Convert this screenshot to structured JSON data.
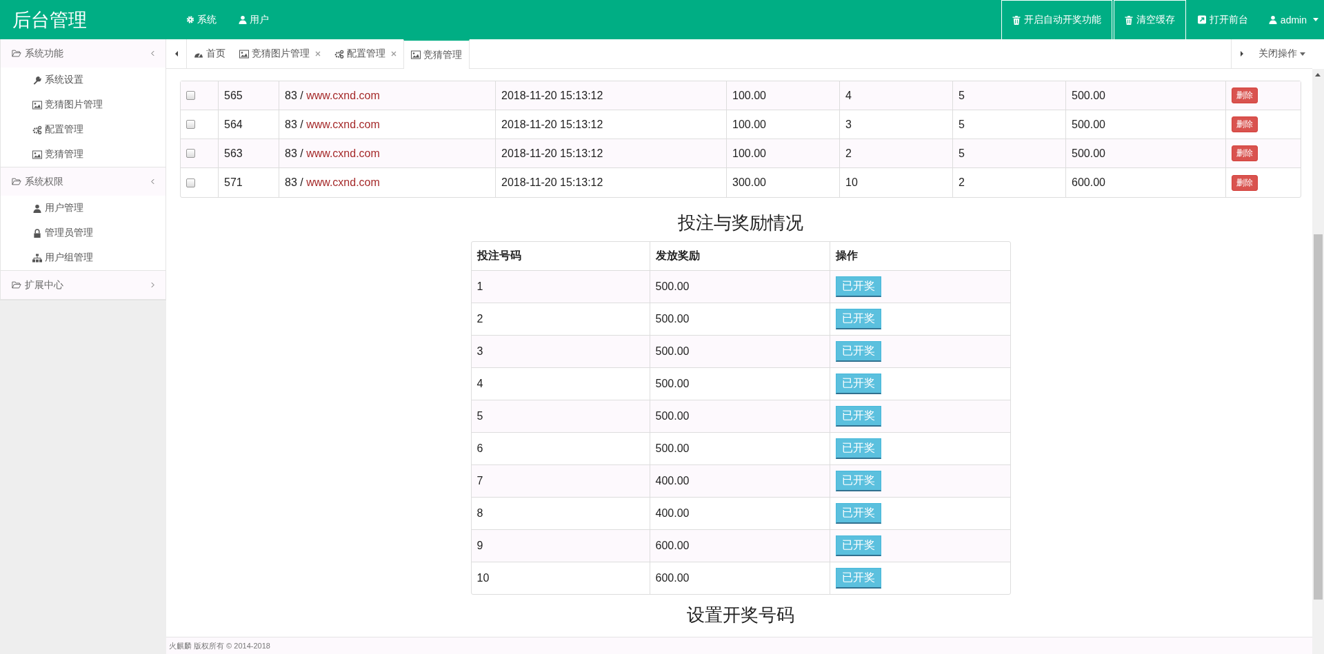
{
  "header": {
    "title": "后台管理",
    "menu": [
      {
        "label": "系统"
      },
      {
        "label": "用户"
      }
    ],
    "actions": [
      {
        "label": "开启自动开奖功能",
        "kind": "boxed"
      },
      {
        "label": "清空缓存",
        "kind": "boxed"
      },
      {
        "label": "打开前台",
        "kind": "plain"
      }
    ],
    "user": "admin"
  },
  "sidebar": {
    "groups": [
      {
        "label": "系统功能",
        "expanded": true,
        "children": [
          {
            "label": "系统设置"
          },
          {
            "label": "竞猜图片管理"
          },
          {
            "label": "配置管理"
          },
          {
            "label": "竞猜管理"
          }
        ]
      },
      {
        "label": "系统权限",
        "expanded": true,
        "children": [
          {
            "label": "用户管理"
          },
          {
            "label": "管理员管理"
          },
          {
            "label": "用户组管理"
          }
        ]
      },
      {
        "label": "扩展中心",
        "expanded": false
      }
    ]
  },
  "tabs": [
    {
      "label": "首页",
      "closable": false,
      "selected": false
    },
    {
      "label": "竞猜图片管理",
      "closable": true,
      "selected": false
    },
    {
      "label": "配置管理",
      "closable": true,
      "selected": false
    },
    {
      "label": "竞猜管理",
      "closable": false,
      "selected": true
    }
  ],
  "tab_close_all": "关闭操作",
  "bets_table": {
    "rows": [
      {
        "checked": false,
        "id": "565",
        "prefix": "83 / ",
        "link": "www.cxnd.com",
        "time": "2018-11-20 15:13:12",
        "column_5": "100.00",
        "column_6": "4",
        "column_7": "5",
        "column_8": "500.00",
        "action": "删除"
      },
      {
        "checked": false,
        "id": "564",
        "prefix": "83 / ",
        "link": "www.cxnd.com",
        "time": "2018-11-20 15:13:12",
        "column_5": "100.00",
        "column_6": "3",
        "column_7": "5",
        "column_8": "500.00",
        "action": "删除"
      },
      {
        "checked": false,
        "id": "563",
        "prefix": "83 / ",
        "link": "www.cxnd.com",
        "time": "2018-11-20 15:13:12",
        "column_5": "100.00",
        "column_6": "2",
        "column_7": "5",
        "column_8": "500.00",
        "action": "删除"
      },
      {
        "checked": false,
        "id": "571",
        "prefix": "83 / ",
        "link": "www.cxnd.com",
        "time": "2018-11-20 15:13:12",
        "column_5": "300.00",
        "column_6": "10",
        "column_7": "2",
        "column_8": "600.00",
        "action": "删除"
      }
    ]
  },
  "rewards": {
    "title": "投注与奖励情况",
    "columns": [
      "投注号码",
      "发放奖励",
      "操作"
    ],
    "rows": [
      {
        "number": "1",
        "reward": "500.00",
        "action": "已开奖"
      },
      {
        "number": "2",
        "reward": "500.00",
        "action": "已开奖"
      },
      {
        "number": "3",
        "reward": "500.00",
        "action": "已开奖"
      },
      {
        "number": "4",
        "reward": "500.00",
        "action": "已开奖"
      },
      {
        "number": "5",
        "reward": "500.00",
        "action": "已开奖"
      },
      {
        "number": "6",
        "reward": "500.00",
        "action": "已开奖"
      },
      {
        "number": "7",
        "reward": "400.00",
        "action": "已开奖"
      },
      {
        "number": "8",
        "reward": "400.00",
        "action": "已开奖"
      },
      {
        "number": "9",
        "reward": "600.00",
        "action": "已开奖"
      },
      {
        "number": "10",
        "reward": "600.00",
        "action": "已开奖"
      }
    ]
  },
  "next_section_title": "设置开奖号码",
  "footer": "火麒麟 版权所有 © 2014-2018"
}
